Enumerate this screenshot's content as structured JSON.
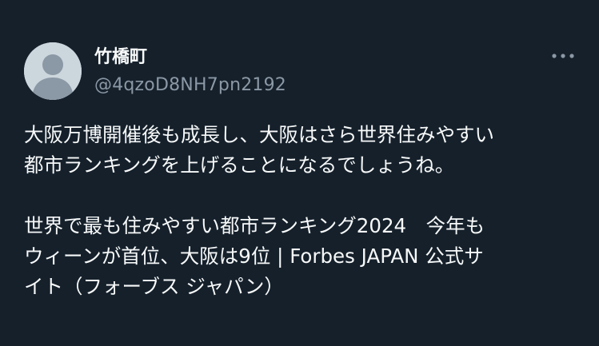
{
  "tweet": {
    "author": {
      "display_name": "竹橋町",
      "handle": "@4qzoD8NH7pn2192",
      "avatar_icon": "default-profile-icon"
    },
    "more_icon": "more-options-icon",
    "paragraph1": {
      "line1": "大阪万博開催後も成長し、大阪はさら世界住みやすい",
      "line2": "都市ランキングを上げることになるでしょうね。"
    },
    "paragraph2": {
      "line1": "世界で最も住みやすい都市ランキング2024　今年も",
      "line2": "ウィーンが首位、大阪は9位 | Forbes JAPAN 公式サ",
      "line3": "イト（フォーブス ジャパン）"
    }
  },
  "colors": {
    "background": "#15202b",
    "primary_text": "#f7f9f9",
    "secondary_text": "#8b98a5",
    "avatar_bg": "#ccd6dd",
    "avatar_figure": "#8b98a5"
  }
}
